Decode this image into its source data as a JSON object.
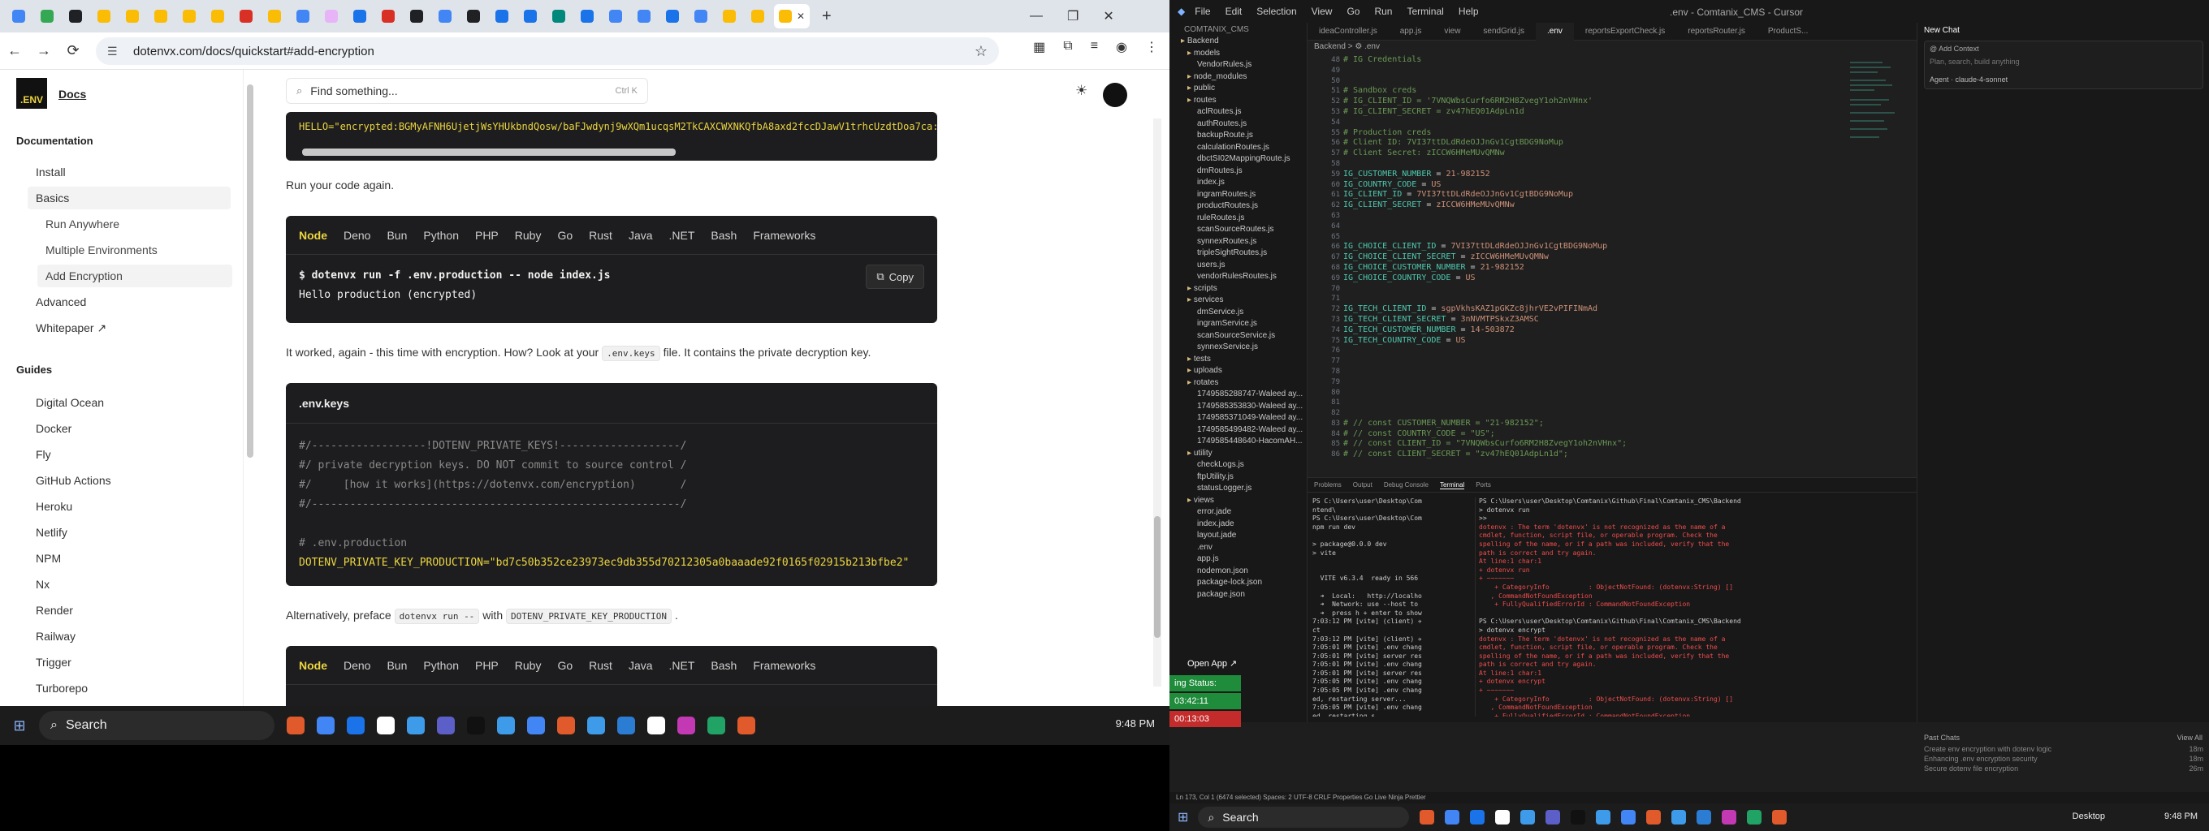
{
  "browser": {
    "url": "dotenvx.com/docs/quickstart#add-encryption",
    "tab_favicon_colors": [
      "#4285f4",
      "#34a853",
      "#202124",
      "#fbbc05",
      "#fbbc05",
      "#fbbc05",
      "#fbbc05",
      "#fbbc05",
      "#d93025",
      "#fbbc05",
      "#4285f4",
      "#e8b4f8",
      "#1a73e8",
      "#d93025",
      "#202124",
      "#4285f4",
      "#202124",
      "#1a73e8",
      "#1a73e8",
      "#00897b",
      "#1a73e8",
      "#4285f4",
      "#4285f4",
      "#1a73e8",
      "#4285f4",
      "#fbbc05",
      "#fbbc05",
      "#fbbc05"
    ]
  },
  "sidebar": {
    "logo_text": ".ENV",
    "logo_link": "Docs",
    "section_documentation": "Documentation",
    "items": [
      "Install",
      "Basics"
    ],
    "basics_sub": [
      "Run Anywhere",
      "Multiple Environments",
      "Add Encryption"
    ],
    "items2": [
      "Advanced",
      "Whitepaper ↗"
    ],
    "section_guides": "Guides",
    "guides": [
      "Digital Ocean",
      "Docker",
      "Fly",
      "GitHub Actions",
      "Heroku",
      "Netlify",
      "NPM",
      "Nx",
      "Render",
      "Railway",
      "Trigger",
      "Turborepo"
    ]
  },
  "main": {
    "search_placeholder": "Find something...",
    "search_shortcut": "Ctrl K",
    "top_code_line": "HELLO=\"encrypted:BGMyAFNH6UjetjWsYHUkbndQosw/baFJwdynj9wXQm1ucqsM2TkCAXCWXNKQfbA8axd2fccDJawV1trhcUzdtDoa7ca:",
    "para1": "Run your code again.",
    "tabs": [
      "Node",
      "Deno",
      "Bun",
      "Python",
      "PHP",
      "Ruby",
      "Go",
      "Rust",
      "Java",
      ".NET",
      "Bash",
      "Frameworks"
    ],
    "code1": [
      "$ dotenvx run -f .env.production -- node index.js",
      "Hello production (encrypted)"
    ],
    "copy_label": "Copy",
    "para2_a": "It worked, again - this time with encryption. How? Look at your",
    "para2_code": ".env.keys",
    "para2_b": "file. It contains the private decryption key.",
    "keys_title": ".env.keys",
    "keys_lines": [
      "#/------------------!DOTENV_PRIVATE_KEYS!-------------------/",
      "#/ private decryption keys. DO NOT commit to source control /",
      "#/     [how it works](https://dotenvx.com/encryption)       /",
      "#/----------------------------------------------------------/",
      "",
      "# .env.production",
      "DOTENV_PRIVATE_KEY_PRODUCTION=\"bd7c50b352ce23973ec9db355d70212305a0baaade92f0165f02915b213bfbe2\""
    ],
    "para3_a": "Alternatively, preface",
    "para3_code1": "dotenvx run --",
    "para3_b": "with",
    "para3_code2": "DOTENV_PRIVATE_KEY_PRODUCTION",
    "para3_c": ".",
    "tabs_bottom": [
      "Node",
      "Deno",
      "Bun",
      "Python",
      "PHP",
      "Ruby",
      "Go",
      "Rust",
      "Java",
      ".NET",
      "Bash",
      "Frameworks"
    ]
  },
  "taskbar_left": {
    "search": "Search",
    "time": "9:48 PM",
    "app_colors": [
      "#e05a2b",
      "#4285f4",
      "#1a73e8",
      "#ffffff",
      "#3d9be9",
      "#5b5fc7",
      "#111111",
      "#3d9be9",
      "#4285f4",
      "#e05a2b",
      "#3d9be9",
      "#2b7cd3",
      "#ffffff",
      "#c239b3",
      "#21a366",
      "#e05a2b"
    ]
  },
  "ide": {
    "menu": [
      "File",
      "Edit",
      "Selection",
      "View",
      "Go",
      "Run",
      "Terminal",
      "Help"
    ],
    "title": ".env - Comtanix_CMS - Cursor",
    "tabs": [
      "ideaController.js",
      "app.js",
      "view",
      "sendGrid.js",
      ".env",
      "reportsExportCheck.js",
      "reportsRouter.js",
      "ProductS..."
    ],
    "breadcrumb": "Backend > ⚙ .env",
    "explorer_header": "COMTANIX_CMS",
    "explorer": [
      "Backend",
      "models",
      "VendorRules.js",
      "node_modules",
      "public",
      "routes",
      "aclRoutes.js",
      "authRoutes.js",
      "backupRoute.js",
      "calculationRoutes.js",
      "dbctSI02MappingRoute.js",
      "dmRoutes.js",
      "index.js",
      "ingramRoutes.js",
      "productRoutes.js",
      "ruleRoutes.js",
      "scanSourceRoutes.js",
      "synnexRoutes.js",
      "tripleSightRoutes.js",
      "users.js",
      "vendorRulesRoutes.js",
      "scripts",
      "services",
      "dmService.js",
      "ingramService.js",
      "scanSourceService.js",
      "synnexService.js",
      "tests",
      "uploads",
      "rotates",
      "1749585288747-Waleed ay...",
      "1749585353830-Waleed ay...",
      "1749585371049-Waleed ay...",
      "1749585499482-Waleed ay...",
      "1749585448640-HacomAH...",
      "utility",
      "checkLogs.js",
      "ftpUtility.js",
      "statusLogger.js",
      "views",
      "error.jade",
      "index.jade",
      "layout.jade",
      ".env",
      "app.js",
      "nodemon.json",
      "package-lock.json",
      "package.json"
    ],
    "line_start": 48,
    "code": [
      {
        "t": "com",
        "s": "# IG Credentials"
      },
      {
        "t": "",
        "s": ""
      },
      {
        "t": "",
        "s": ""
      },
      {
        "t": "com",
        "s": "# Sandbox creds"
      },
      {
        "t": "com",
        "s": "# IG_CLIENT_ID = '7VNQWbsCurfo6RM2H8ZvegY1oh2nVHnx'"
      },
      {
        "t": "com",
        "s": "# IG_CLIENT_SECRET = zv47hEQ01AdpLn1d"
      },
      {
        "t": "",
        "s": ""
      },
      {
        "t": "com",
        "s": "# Production creds"
      },
      {
        "t": "com",
        "s": "# Client ID: 7VI37ttDLdRdeOJJnGv1CgtBDG9NoMup"
      },
      {
        "t": "com",
        "s": "# Client Secret: zICCW6HMeMUvQMNw"
      },
      {
        "t": "",
        "s": ""
      },
      {
        "t": "kv",
        "k": "IG_CUSTOMER_NUMBER",
        "v": "21-982152"
      },
      {
        "t": "kv",
        "k": "IG_COUNTRY_CODE",
        "v": "US"
      },
      {
        "t": "kv",
        "k": "IG_CLIENT_ID",
        "v": "7VI37ttDLdRdeOJJnGv1CgtBDG9NoMup"
      },
      {
        "t": "kv",
        "k": "IG_CLIENT_SECRET",
        "v": "zICCW6HMeMUvQMNw"
      },
      {
        "t": "",
        "s": ""
      },
      {
        "t": "",
        "s": ""
      },
      {
        "t": "",
        "s": ""
      },
      {
        "t": "kv",
        "k": "IG_CHOICE_CLIENT_ID",
        "v": "7VI37ttDLdRdeOJJnGv1CgtBDG9NoMup"
      },
      {
        "t": "kv",
        "k": "IG_CHOICE_CLIENT_SECRET",
        "v": "zICCW6HMeMUvQMNw"
      },
      {
        "t": "kv",
        "k": "IG_CHOICE_CUSTOMER_NUMBER",
        "v": "21-982152"
      },
      {
        "t": "kv",
        "k": "IG_CHOICE_COUNTRY_CODE",
        "v": "US"
      },
      {
        "t": "",
        "s": ""
      },
      {
        "t": "",
        "s": ""
      },
      {
        "t": "kv",
        "k": "IG_TECH_CLIENT_ID",
        "v": "sgpVkhsKAZ1pGKZc8jhrVE2vPIFINmAd"
      },
      {
        "t": "kv",
        "k": "IG_TECH_CLIENT_SECRET",
        "v": "3nNVMTPSkxZ3AMSC"
      },
      {
        "t": "kv",
        "k": "IG_TECH_CUSTOMER_NUMBER",
        "v": "14-503872"
      },
      {
        "t": "kv",
        "k": "IG_TECH_COUNTRY_CODE",
        "v": "US"
      },
      {
        "t": "",
        "s": ""
      },
      {
        "t": "",
        "s": ""
      },
      {
        "t": "",
        "s": ""
      },
      {
        "t": "",
        "s": ""
      },
      {
        "t": "",
        "s": ""
      },
      {
        "t": "",
        "s": ""
      },
      {
        "t": "",
        "s": ""
      },
      {
        "t": "com",
        "s": "# // const CUSTOMER_NUMBER = \"21-982152\";"
      },
      {
        "t": "com",
        "s": "# // const COUNTRY_CODE = \"US\";"
      },
      {
        "t": "com",
        "s": "# // const CLIENT_ID = \"7VNQWbsCurfo6RM2H8ZvegY1oh2nVHnx\";"
      },
      {
        "t": "com",
        "s": "# // const CLIENT_SECRET = \"zv47hEQ01AdpLn1d\";"
      }
    ],
    "terminal_tabs": [
      "Problems",
      "Output",
      "Debug Console",
      "Terminal",
      "Ports"
    ],
    "term_left": [
      "PS C:\\Users\\user\\Desktop\\Com",
      "ntend\\",
      "PS C:\\Users\\user\\Desktop\\Com",
      "npm run dev",
      "",
      "> package@0.0.0 dev",
      "> vite",
      "",
      "",
      "  VITE v6.3.4  ready in 566",
      "",
      "  ➜  Local:   http://localho",
      "  ➜  Network: use --host to",
      "  ➜  press h + enter to show",
      "7:03:12 PM [vite] (client) ✈",
      "ct",
      "7:03:12 PM [vite] (client) ✈",
      "7:05:01 PM [vite] .env chang",
      "7:05:01 PM [vite] server res",
      "7:05:01 PM [vite] .env chang",
      "7:05:01 PM [vite] server res",
      "7:05:05 PM [vite] .env chang",
      "7:05:05 PM [vite] .env chang",
      "ed, restarting server...",
      "7:05:05 PM [vite] .env chang",
      "ed, restarting s",
      "7:05:05 PM [vite] .env chang"
    ],
    "term_right": [
      {
        "t": "",
        "s": "PS C:\\Users\\user\\Desktop\\Comtanix\\Github\\Final\\Comtanix_CMS\\Backend"
      },
      {
        "t": "",
        "s": "> dotenvx run"
      },
      {
        "t": "",
        "s": ">>"
      },
      {
        "t": "err",
        "s": "dotenvx : The term 'dotenvx' is not recognized as the name of a"
      },
      {
        "t": "err",
        "s": "cmdlet, function, script file, or operable program. Check the"
      },
      {
        "t": "err",
        "s": "spelling of the name, or if a path was included, verify that the"
      },
      {
        "t": "err",
        "s": "path is correct and try again."
      },
      {
        "t": "err",
        "s": "At line:1 char:1"
      },
      {
        "t": "err",
        "s": "+ dotenvx run"
      },
      {
        "t": "err",
        "s": "+ ~~~~~~~"
      },
      {
        "t": "err",
        "s": "    + CategoryInfo          : ObjectNotFound: (dotenvx:String) []"
      },
      {
        "t": "err",
        "s": "   , CommandNotFoundException"
      },
      {
        "t": "err",
        "s": "    + FullyQualifiedErrorId : CommandNotFoundException"
      },
      {
        "t": "",
        "s": ""
      },
      {
        "t": "",
        "s": "PS C:\\Users\\user\\Desktop\\Comtanix\\Github\\Final\\Comtanix_CMS\\Backend"
      },
      {
        "t": "",
        "s": "> dotenvx encrypt"
      },
      {
        "t": "err",
        "s": "dotenvx : The term 'dotenvx' is not recognized as the name of a"
      },
      {
        "t": "err",
        "s": "cmdlet, function, script file, or operable program. Check the"
      },
      {
        "t": "err",
        "s": "spelling of the name, or if a path was included, verify that the"
      },
      {
        "t": "err",
        "s": "path is correct and try again."
      },
      {
        "t": "err",
        "s": "At line:1 char:1"
      },
      {
        "t": "err",
        "s": "+ dotenvx encrypt"
      },
      {
        "t": "err",
        "s": "+ ~~~~~~~"
      },
      {
        "t": "err",
        "s": "    + CategoryInfo          : ObjectNotFound: (dotenvx:String) []"
      },
      {
        "t": "err",
        "s": "   , CommandNotFoundException"
      },
      {
        "t": "err",
        "s": "    + FullyQualifiedErrorId : CommandNotFoundException"
      },
      {
        "t": "",
        "s": ""
      },
      {
        "t": "",
        "s": "PS C:\\Users\\user\\Desktop\\Comtanix\\Github\\Final\\Comtanix_CMS\\Backend"
      },
      {
        "t": "",
        "s": "> ▌"
      }
    ],
    "chat_title": "New Chat",
    "chat_add_context": "Add Context",
    "chat_placeholder": "Plan, search, build anything",
    "chat_agent": "Agent",
    "chat_model": "claude-4-sonnet",
    "past_chats_title": "Past Chats",
    "view_all": "View All",
    "past_chats": [
      {
        "title": "Create env encryption with dotenv logic",
        "age": "18m"
      },
      {
        "title": "Enhancing .env encryption security",
        "age": "18m"
      },
      {
        "title": "Secure dotenv file encryption",
        "age": "26m"
      }
    ],
    "status_active": "ing Status: Active",
    "timer1": "03:42:11",
    "timer2": "00:13:03",
    "open_app": "Open App ↗",
    "statusbar": "Ln 173, Col 1 (6474 selected)   Spaces: 2   UTF-8   CRLF   Properties   Go Live   Ninja   Prettier",
    "time": "9:48 PM",
    "desktop_label": "Desktop"
  }
}
